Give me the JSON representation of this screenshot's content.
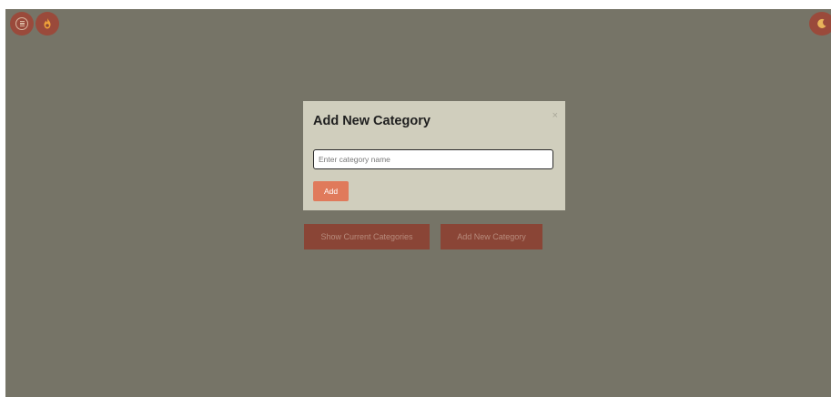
{
  "header": {
    "menu_icon": "menu-icon",
    "logo_icon": "fire-logo-icon",
    "theme_icon": "moon-icon"
  },
  "main": {
    "show_categories_label": "Show Current Categories",
    "add_category_label": "Add New Category"
  },
  "modal": {
    "title": "Add New Category",
    "close_glyph": "×",
    "input_placeholder": "Enter category name",
    "input_value": "",
    "add_label": "Add"
  },
  "colors": {
    "overlay": "#767467",
    "modal_bg": "#d0cebd",
    "accent": "#e07a5b",
    "brand_dark": "#9a4a3b"
  }
}
